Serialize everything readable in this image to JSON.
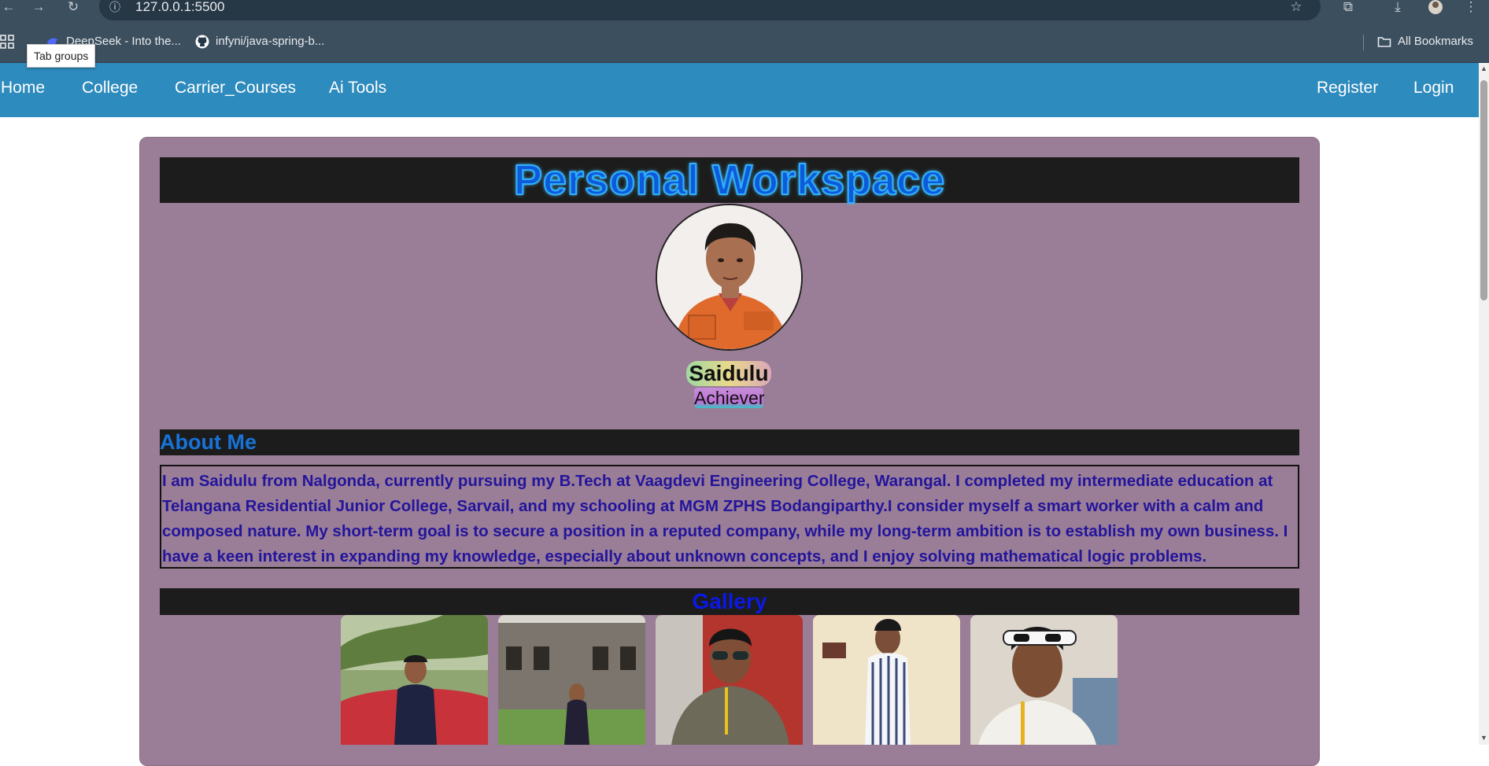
{
  "browser": {
    "url": "127.0.0.1:5500",
    "tab_groups_tooltip": "Tab groups",
    "bookmarks": [
      {
        "label": "DeepSeek - Into the..."
      },
      {
        "label": "infyni/java-spring-b..."
      }
    ],
    "all_bookmarks": "All Bookmarks"
  },
  "nav": {
    "left": [
      "Home",
      "College",
      "Carrier_Courses",
      "Ai Tools"
    ],
    "right": [
      "Register",
      "Login"
    ]
  },
  "workspace": {
    "title": "Personal Workspace",
    "name": "Saidulu",
    "role": "Achiever"
  },
  "about": {
    "heading": "About Me",
    "lines": [
      "I am Saidulu from Nalgonda, currently pursuing my B.Tech at Vaagdevi Engineering College, Warangal. I completed my intermediate education at",
      "Telangana Residential Junior College, Sarvail, and my schooling at MGM ZPHS Bodangiparthy.I consider myself a smart worker with a calm and",
      "composed nature. My short-term goal is to secure a position in a reputed company, while my long-term ambition is to establish my own business. I",
      "have a keen interest in expanding my knowledge, especially about unknown concepts, and I enjoy solving mathematical logic problems."
    ]
  },
  "gallery": {
    "heading": "Gallery"
  },
  "colors": {
    "nav": "#2e8bbd",
    "card": "#9a7d96",
    "banner": "#1c1c1c",
    "about_text": "#23159c",
    "gallery_title": "#0c18e6"
  }
}
